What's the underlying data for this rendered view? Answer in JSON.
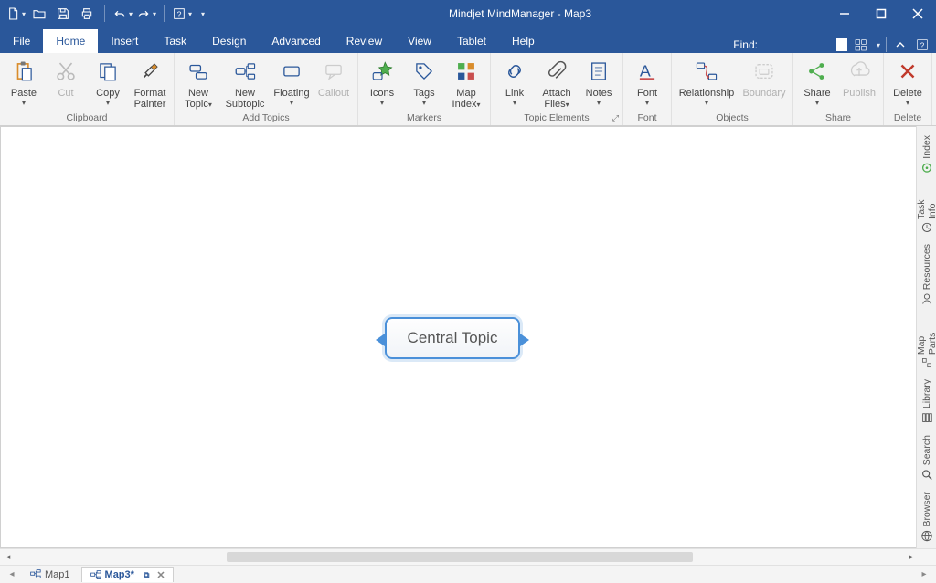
{
  "app": {
    "title": "Mindjet MindManager - Map3"
  },
  "qat": {
    "new_dd": "▾",
    "open": "open",
    "save": "save",
    "print": "print",
    "undo_dd": "▾",
    "redo_dd": "▾",
    "help_dd": "▾",
    "more_dd": "▾"
  },
  "tabs": {
    "file": "File",
    "home": "Home",
    "insert": "Insert",
    "task": "Task",
    "design": "Design",
    "advanced": "Advanced",
    "review": "Review",
    "view": "View",
    "tablet": "Tablet",
    "help": "Help"
  },
  "find": {
    "label": "Find:"
  },
  "ribbon": {
    "clipboard": {
      "label": "Clipboard",
      "paste": "Paste",
      "cut": "Cut",
      "copy": "Copy",
      "format_painter_line1": "Format",
      "format_painter_line2": "Painter"
    },
    "add_topics": {
      "label": "Add Topics",
      "new_topic_l1": "New",
      "new_topic_l2": "Topic",
      "new_subtopic_l1": "New",
      "new_subtopic_l2": "Subtopic",
      "floating": "Floating",
      "callout": "Callout"
    },
    "markers": {
      "label": "Markers",
      "icons": "Icons",
      "tags": "Tags",
      "map_index_l1": "Map",
      "map_index_l2": "Index"
    },
    "topic_elements": {
      "label": "Topic Elements",
      "link": "Link",
      "attach_l1": "Attach",
      "attach_l2": "Files",
      "notes": "Notes"
    },
    "font": {
      "label": "Font",
      "font": "Font"
    },
    "objects": {
      "label": "Objects",
      "relationship": "Relationship",
      "boundary": "Boundary"
    },
    "share": {
      "label": "Share",
      "share": "Share",
      "publish": "Publish"
    },
    "delete": {
      "label": "Delete",
      "delete": "Delete"
    }
  },
  "canvas": {
    "central_topic": "Central Topic"
  },
  "doctabs": {
    "map1": "Map1",
    "map3": "Map3*"
  },
  "sidepanel": {
    "index": "Index",
    "task_info": "Task Info",
    "resources": "Resources",
    "map_parts": "Map Parts",
    "library": "Library",
    "search": "Search",
    "browser": "Browser"
  }
}
